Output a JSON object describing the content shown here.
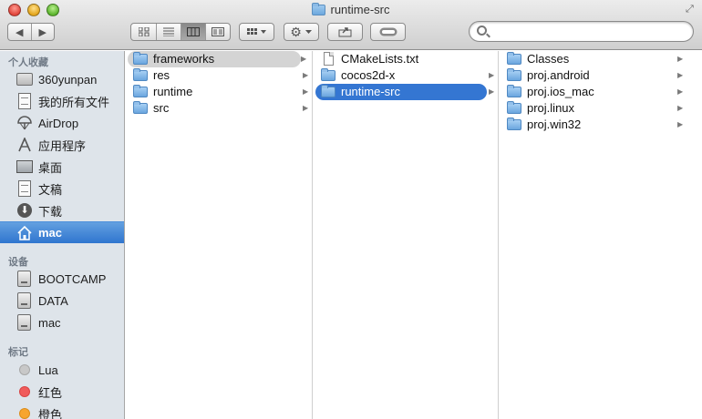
{
  "window": {
    "title": "runtime-src"
  },
  "toolbar": {
    "back_icon": "chevron-left-icon",
    "forward_icon": "chevron-right-icon",
    "view_modes": [
      "icon-view",
      "list-view",
      "column-view",
      "cover-flow-view"
    ],
    "active_view": "column-view",
    "arrange_icon": "arrange-grid-icon",
    "action_icon": "gear-icon",
    "share_icon": "share-icon",
    "tag_icon": "tag-toggle-icon",
    "search": {
      "value": "",
      "placeholder": ""
    }
  },
  "sidebar": {
    "favorites_header": "个人收藏",
    "favorites": [
      {
        "label": "360yunpan",
        "icon": "folder-icon"
      },
      {
        "label": "我的所有文件",
        "icon": "all-files-icon"
      },
      {
        "label": "AirDrop",
        "icon": "airdrop-icon"
      },
      {
        "label": "应用程序",
        "icon": "applications-icon"
      },
      {
        "label": "桌面",
        "icon": "desktop-icon"
      },
      {
        "label": "文稿",
        "icon": "documents-icon"
      },
      {
        "label": "下载",
        "icon": "downloads-icon"
      },
      {
        "label": "mac",
        "icon": "home-icon",
        "selected": true
      }
    ],
    "devices_header": "设备",
    "devices": [
      {
        "label": "BOOTCAMP",
        "icon": "drive-icon"
      },
      {
        "label": "DATA",
        "icon": "drive-icon"
      },
      {
        "label": "mac",
        "icon": "drive-icon"
      }
    ],
    "tags_header": "标记",
    "tags": [
      {
        "label": "Lua",
        "color": "#c8c8c8"
      },
      {
        "label": "红色",
        "color": "#f05b5b"
      },
      {
        "label": "橙色",
        "color": "#f7a52f"
      }
    ]
  },
  "columns": [
    {
      "items": [
        {
          "name": "frameworks",
          "type": "folder",
          "selected": "gray"
        },
        {
          "name": "res",
          "type": "folder"
        },
        {
          "name": "runtime",
          "type": "folder"
        },
        {
          "name": "src",
          "type": "folder"
        }
      ]
    },
    {
      "items": [
        {
          "name": "CMakeLists.txt",
          "type": "file"
        },
        {
          "name": "cocos2d-x",
          "type": "folder"
        },
        {
          "name": "runtime-src",
          "type": "folder",
          "selected": "blue"
        }
      ]
    },
    {
      "items": [
        {
          "name": "Classes",
          "type": "folder"
        },
        {
          "name": "proj.android",
          "type": "folder"
        },
        {
          "name": "proj.ios_mac",
          "type": "folder"
        },
        {
          "name": "proj.linux",
          "type": "folder"
        },
        {
          "name": "proj.win32",
          "type": "folder"
        }
      ]
    }
  ],
  "colors": {
    "selection_blue": "#3476d2",
    "sidebar_bg": "#dee4ea",
    "sidebar_selected": "#2f75cf"
  }
}
